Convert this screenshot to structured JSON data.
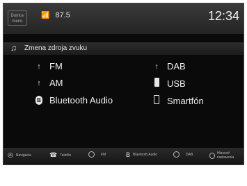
{
  "header": {
    "home_label": "Domov\nmenu",
    "station": "87.5",
    "clock": "12:34"
  },
  "title_bar": {
    "title": "Zmena zdroja zvuku"
  },
  "sources": [
    {
      "label": "FM",
      "icon": "antenna-icon"
    },
    {
      "label": "DAB",
      "icon": "antenna-icon"
    },
    {
      "label": "AM",
      "icon": "antenna-icon"
    },
    {
      "label": "USB",
      "icon": "usb-icon"
    },
    {
      "label": "Bluetooth Audio",
      "icon": "bluetooth-icon"
    },
    {
      "label": "Smartfón",
      "icon": "smartphone-icon"
    }
  ],
  "bottom_bar": [
    {
      "label": "Navigácia",
      "icon": "navigation-icon"
    },
    {
      "label": "Telefón",
      "icon": "phone-icon"
    },
    {
      "label": "FM",
      "icon": "antenna-icon"
    },
    {
      "label": "Bluetooth Audio",
      "icon": "bluetooth-icon"
    },
    {
      "label": "DAB",
      "icon": "antenna-icon"
    },
    {
      "label": "Hlasové nastavenia",
      "icon": "voice-icon"
    }
  ]
}
